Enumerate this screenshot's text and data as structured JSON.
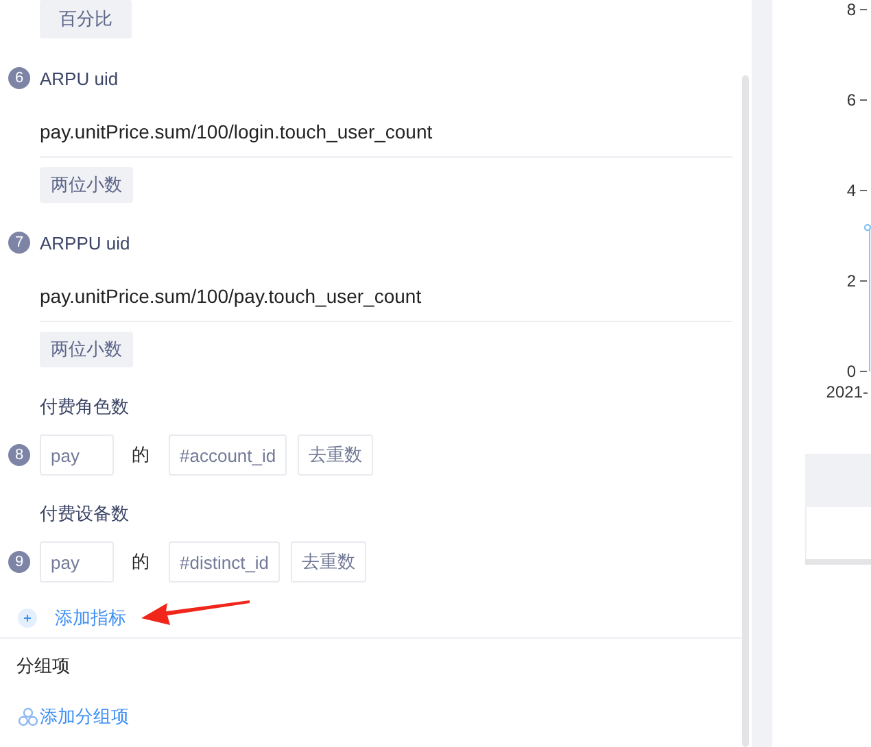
{
  "metrics": [
    {
      "kind": "format_only",
      "format": "百分比"
    },
    {
      "kind": "formula",
      "index": "6",
      "name": "ARPU uid",
      "formula": "pay.unitPrice.sum/100/login.touch_user_count",
      "format": "两位小数"
    },
    {
      "kind": "formula",
      "index": "7",
      "name": "ARPPU uid",
      "formula": "pay.unitPrice.sum/100/pay.touch_user_count",
      "format": "两位小数"
    },
    {
      "kind": "event",
      "index": "8",
      "name": "付费角色数",
      "event": "pay",
      "connector": "的",
      "property": "#account_id",
      "aggregate": "去重数"
    },
    {
      "kind": "event",
      "index": "9",
      "name": "付费设备数",
      "event": "pay",
      "connector": "的",
      "property": "#distinct_id",
      "aggregate": "去重数"
    }
  ],
  "add_metric": {
    "label": "添加指标"
  },
  "grouping": {
    "title": "分组项",
    "add_label": "添加分组项"
  },
  "chart": {
    "y_labels": [
      "8",
      "6",
      "4",
      "2",
      "0"
    ],
    "x_labels": [
      "2021-"
    ]
  }
}
